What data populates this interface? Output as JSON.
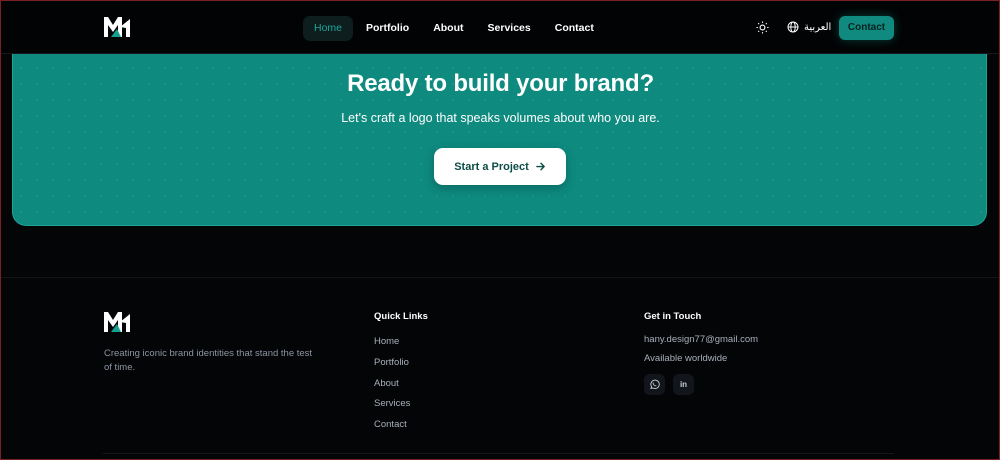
{
  "nav": {
    "logo": "mh-logo",
    "links": [
      {
        "label": "Home",
        "active": true
      },
      {
        "label": "Portfolio",
        "active": false
      },
      {
        "label": "About",
        "active": false
      },
      {
        "label": "Services",
        "active": false
      },
      {
        "label": "Contact",
        "active": false
      }
    ],
    "theme_icon": "sun-icon",
    "language_icon": "globe-icon",
    "language_label": "العربية",
    "contact_button": "Contact"
  },
  "cta": {
    "title": "Ready to build your brand?",
    "subtitle": "Let's craft a logo that speaks volumes about who you are.",
    "button_label": "Start a Project",
    "button_icon": "arrow-right-icon"
  },
  "footer": {
    "tagline": "Creating iconic brand identities that stand the test of time.",
    "quick_links_title": "Quick Links",
    "quick_links": [
      "Home",
      "Portfolio",
      "About",
      "Services",
      "Contact"
    ],
    "contact_title": "Get in Touch",
    "email": "hany.design77@gmail.com",
    "availability": "Available worldwide",
    "socials": [
      {
        "icon": "whatsapp-icon"
      },
      {
        "icon": "linkedin-icon",
        "label": "in"
      }
    ]
  },
  "colors": {
    "accent": "#0e8a7f",
    "background": "#040507",
    "muted_text": "#8d96a3"
  }
}
